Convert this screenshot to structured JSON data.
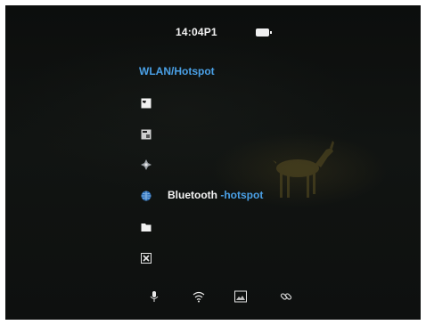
{
  "status": {
    "time": "14:04P1"
  },
  "menu": {
    "title": "WLAN/Hotspot",
    "items": [
      {
        "icon": "photo-icon"
      },
      {
        "icon": "gallery-icon"
      },
      {
        "icon": "crosshair-icon"
      },
      {
        "icon": "globe-icon",
        "label": "Bluetooth",
        "suffix": " -hotspot"
      },
      {
        "icon": "folder-icon"
      },
      {
        "icon": "close-icon"
      }
    ]
  },
  "toolbar": {
    "icons": [
      "microphone-icon",
      "wifi-icon",
      "image-mode-icon",
      "link-icon"
    ]
  },
  "colors": {
    "accent": "#4aa0e6",
    "text": "#f4f4f4",
    "background": "#0f1211"
  }
}
